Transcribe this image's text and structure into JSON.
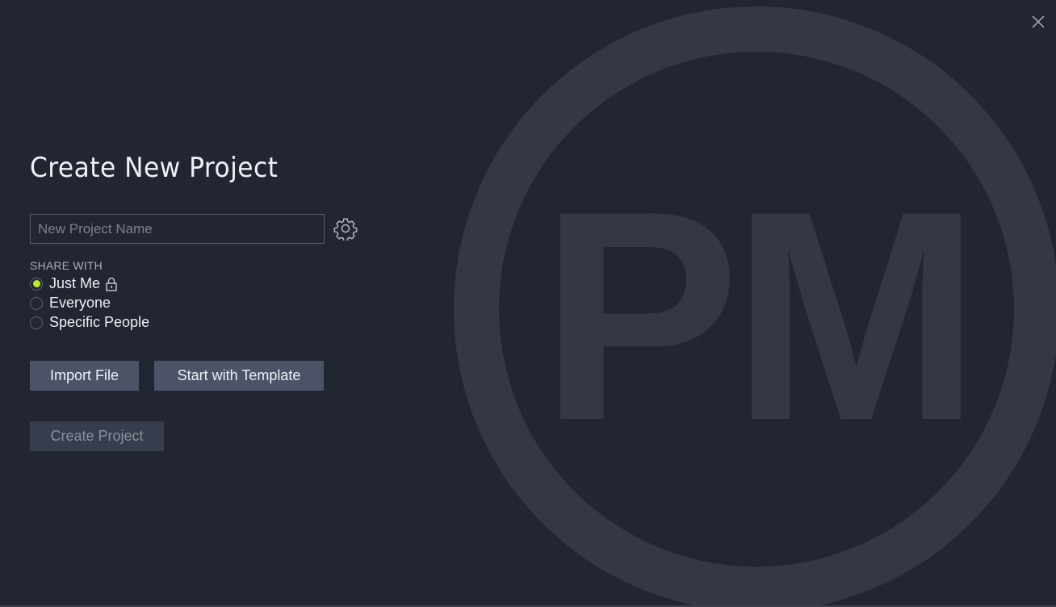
{
  "dialog": {
    "title": "Create New Project",
    "close_icon": "close-icon",
    "watermark_text": "PM"
  },
  "form": {
    "project_name": {
      "value": "",
      "placeholder": "New Project Name"
    },
    "settings_icon": "gear-icon",
    "share_with": {
      "label": "SHARE WITH",
      "selected": "Just Me",
      "options": [
        {
          "label": "Just Me",
          "checked": true,
          "icon": "lock-icon"
        },
        {
          "label": "Everyone",
          "checked": false
        },
        {
          "label": "Specific People",
          "checked": false
        }
      ]
    },
    "buttons": {
      "import_file": "Import File",
      "start_with_template": "Start with Template",
      "create_project": "Create Project"
    }
  },
  "colors": {
    "background": "#222633",
    "accent_radio": "#b8ef12",
    "button": "#4d5367",
    "button_disabled": "#383d4d",
    "watermark": "#343845"
  }
}
